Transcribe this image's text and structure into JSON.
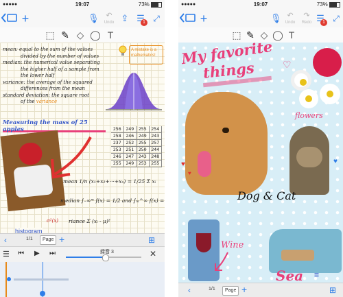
{
  "status": {
    "time": "19:07",
    "battery": "73%",
    "battery_level": 0.73
  },
  "toolbar": {
    "undo_label": "Undo",
    "redo_label": "Redo",
    "badge_count": "1"
  },
  "left_screen": {
    "notes": {
      "line1": "mean: equal to the sum of the values",
      "line2": "divided by the number of values",
      "line3": "median: the numerical value separating",
      "line4": "the higher half of a sample from",
      "line5": "the lower half",
      "line6": "variance: the average of the squared",
      "line7": "differences from the mean",
      "line8": "standard deviation: the square root",
      "line9": "of the",
      "line9_highlight": "variance",
      "bulb_note_1": "A mistake is a",
      "bulb_note_2": "mathematics!",
      "heading": "Measuring the mass of 25 apples",
      "mean_formula": "mean  1/n (x₁+x₂+···+xₙ) = 1/25 Σ xᵢ",
      "median_formula": "median  ∫₋∞ᵐ f(x) = 1/2  and  ∫ₘ^∞ f(x) = 1/2",
      "variance_formula": "riance  Σ (xᵢ - μ)²",
      "variance_side": "σ²(x)",
      "table_rows": [
        [
          "256",
          "249",
          "255",
          "254"
        ],
        [
          "258",
          "246",
          "249",
          "243"
        ],
        [
          "237",
          "252",
          "255",
          "257"
        ],
        [
          "253",
          "251",
          "250",
          "244"
        ],
        [
          "246",
          "247",
          "243",
          "248"
        ],
        [
          "255",
          "249",
          "253",
          "255"
        ]
      ]
    },
    "audio_label": "histogram",
    "page_indicator": "1/1",
    "page_label": "Page",
    "audio_title": "録音 3"
  },
  "right_screen": {
    "title_line1": "My favorite",
    "title_line2": "things",
    "caption_pets": "Dog & Cat",
    "caption_wine": "Wine",
    "caption_flower": "flowers",
    "caption_sea": "Sea",
    "page_indicator": "1/1",
    "page_label": "Page"
  },
  "colors": {
    "accent": "#2f7ee8",
    "highlight_pink": "#e8407a",
    "heading_blue": "#3456c8",
    "arrow_red": "#e03030",
    "note_orange": "#e88a1a",
    "chart_purple": "#6a3ec8"
  }
}
